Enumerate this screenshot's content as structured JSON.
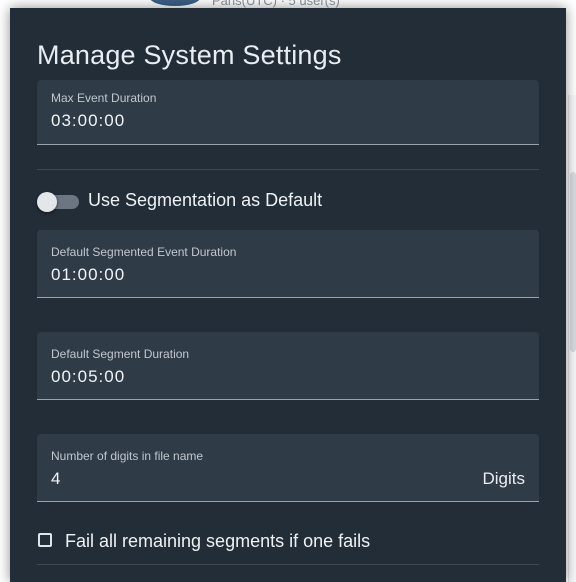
{
  "background": {
    "partial_text": "Paris(UTC) · 5 user(s)"
  },
  "dialog": {
    "title": "Manage System Settings",
    "max_event_duration": {
      "label": "Max Event Duration",
      "value": "03:00:00"
    },
    "use_segmentation": {
      "label": "Use Segmentation as Default",
      "enabled": false
    },
    "default_segmented_event_duration": {
      "label": "Default Segmented Event Duration",
      "value": "01:00:00"
    },
    "default_segment_duration": {
      "label": "Default Segment Duration",
      "value": "00:05:00"
    },
    "digits_in_file_name": {
      "label": "Number of digits in file name",
      "value": "4",
      "suffix": "Digits"
    },
    "fail_remaining_segments": {
      "label": "Fail all remaining segments if one fails",
      "checked": false
    }
  },
  "colors": {
    "dialog_bg": "#222d38",
    "field_bg": "#2f3b47",
    "text": "#eef2f5"
  }
}
